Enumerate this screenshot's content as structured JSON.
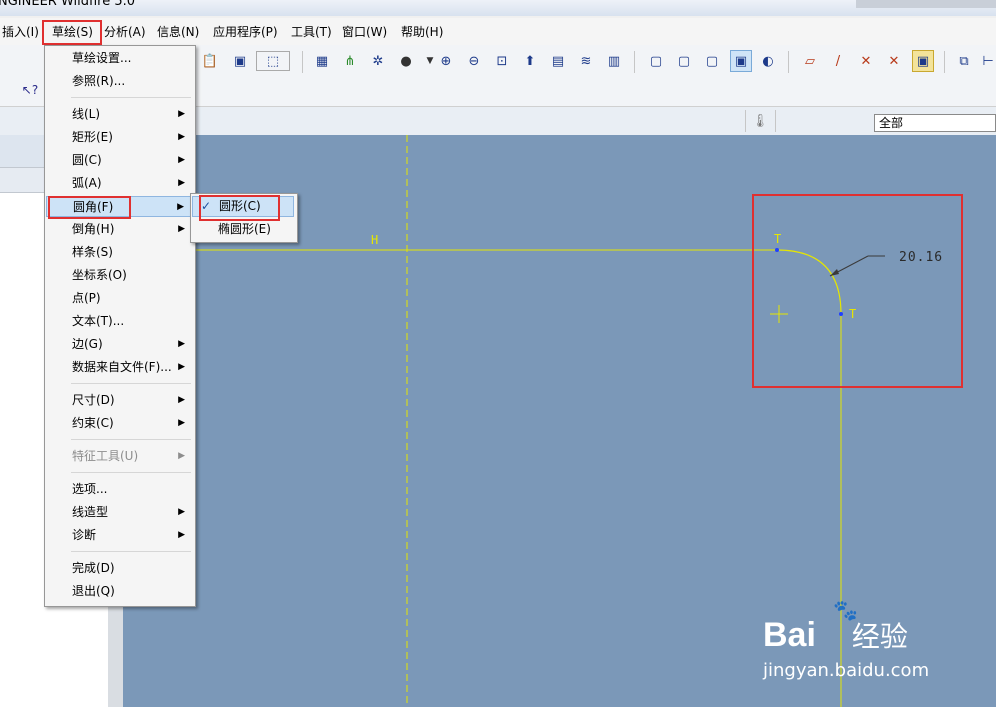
{
  "app": {
    "title": "NGINEER Wildfire 5.0"
  },
  "menubar": {
    "items": [
      "插入(I)",
      "草绘(S)",
      "分析(A)",
      "信息(N)",
      "应用程序(P)",
      "工具(T)",
      "窗口(W)",
      "帮助(H)"
    ]
  },
  "sketch_menu": {
    "items": [
      "草绘设置...",
      "参照(R)...",
      "线(L)",
      "矩形(E)",
      "圆(C)",
      "弧(A)",
      "圆角(F)",
      "倒角(H)",
      "样条(S)",
      "坐标系(O)",
      "点(P)",
      "文本(T)...",
      "边(G)",
      "数据来自文件(F)...",
      "尺寸(D)",
      "约束(C)",
      "特征工具(U)",
      "选项...",
      "线造型",
      "诊断",
      "完成(D)",
      "退出(Q)"
    ]
  },
  "fillet_submenu": {
    "items": [
      "圆形(C)",
      "椭圆形(E)"
    ],
    "checked": "圆形(C)"
  },
  "filter_combo": {
    "value": "全部"
  },
  "sketch": {
    "h_label": "H",
    "t_label_1": "T",
    "t_label_2": "T",
    "dimension": "20.16",
    "line_color": "#e6e600"
  },
  "watermark": {
    "brand": "Bai",
    "brand2": "经验",
    "url": "jingyan.baidu.com"
  },
  "colors": {
    "canvas": "#7b98b8",
    "highlight": "#e03030",
    "sketch": "#e6e600"
  }
}
